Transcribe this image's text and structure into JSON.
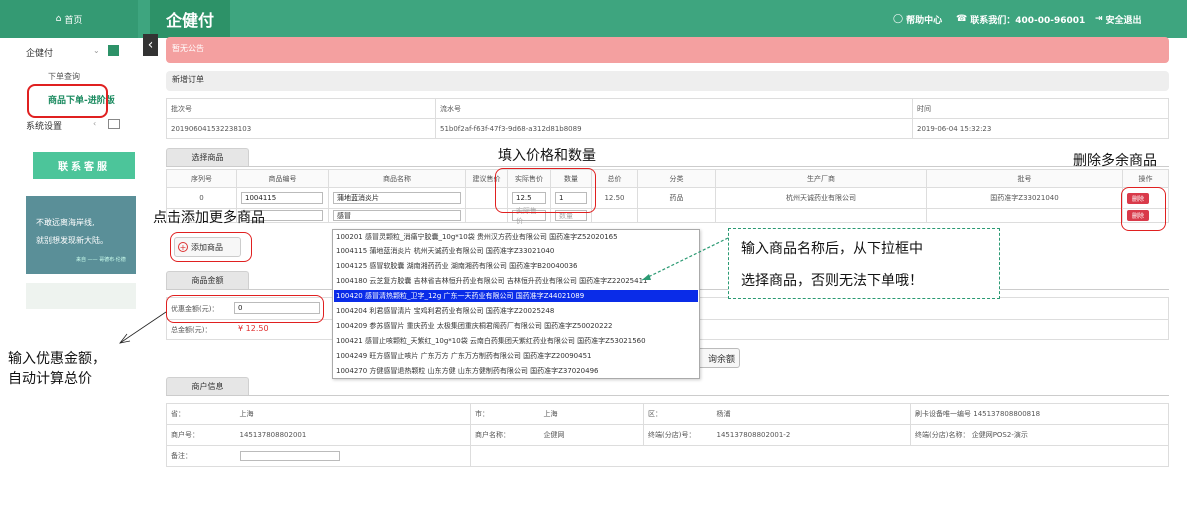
{
  "topbar": {
    "home": "首页",
    "brand": "企健付",
    "help": "帮助中心",
    "contact": "联系我们：400-00-96001",
    "logout": "安全退出"
  },
  "sidebar": {
    "group1": "企健付",
    "item_query": "下单查询",
    "item_order": "商品下单-进阶版",
    "group2": "系统设置",
    "kefu": "联系客服",
    "promo_line1": "不敢远离海岸线,",
    "promo_line2": "就别想发现新大陆。",
    "promo_line3": "来自 —— 哥德布·伦德"
  },
  "notice": "暂无公告",
  "new_order": {
    "title": "新增订单",
    "batch_label": "批次号",
    "batch_value": "201906041532238103",
    "serial_label": "流水号",
    "serial_value": "51b0f2af-f63f-47f3-9d68-a312d81b8089",
    "time_label": "时间",
    "time_value": "2019-06-04 15:32:23"
  },
  "goods": {
    "title": "选择商品",
    "columns": [
      "序列号",
      "商品编号",
      "商品名称",
      "建议售价",
      "实际售价",
      "数量",
      "总价",
      "分类",
      "生产厂商",
      "批号",
      "操作"
    ],
    "row1": {
      "seq": "0",
      "code": "1004115",
      "name": "蒲地蓝消炎片",
      "price": "12.5",
      "qty": "1",
      "total": "12.50",
      "category": "药品",
      "maker": "杭州天诚药业有限公司",
      "batch": "国药准字Z33021040",
      "action": "删除"
    },
    "row2": {
      "name": "感冒",
      "price_ph": "实际售价",
      "qty_ph": "数量",
      "action": "删除"
    },
    "add_button": "添加商品"
  },
  "dropdown": [
    "100201 感冒灵颗粒_消痛宁胶囊_10g*10袋 贵州汉方药业有限公司 国药准字Z52020165",
    "1004115 蒲地蓝消炎片 杭州天诚药业有限公司 国药准字Z33021040",
    "1004125 感冒软胶囊 湖南湘药药业 湖南湘药有限公司 国药准字B20040036",
    "1004180 云芝复方胶囊 吉林省吉林恒升药业有限公司 吉林恒升药业有限公司 国药准字Z22025411",
    "100420 感冒清热颗粒_卫字_12g 广东一天药业有限公司 国药准字Z44021089",
    "1004204 利君感冒清片 宝鸡利君药业有限公司 国药准字Z20025248",
    "1004209 参苏感冒片 重庆药业 太极集团重庆桐君阁药厂有限公司 国药准字Z50020222",
    "100421 感冒止咳颗粒_天紫红_10g*10袋 云南白药集团天紫红药业有限公司 国药准字Z53021560",
    "1004249 旺方感冒止咳片 广东万方 广东万方制药有限公司 国药准字Z20090451",
    "1004270 方健感冒退热颗粒 山东方健 山东方健制药有限公司 国药准字Z37020496"
  ],
  "amount": {
    "title": "商品金额",
    "discount_label": "优惠金额(元)：",
    "discount_value": "0",
    "total_label": "总金额(元)：",
    "total_value": "¥ 12.50",
    "query_button": "询余额"
  },
  "merchant": {
    "title": "商户信息",
    "province_label": "省：",
    "province_value": "上海",
    "city_label": "市：",
    "city_value": "上海",
    "district_label": "区：",
    "district_value": "杨浦",
    "device_label": "刷卡设备唯一编号",
    "device_value": "145137808800818",
    "merchant_no_label": "商户号：",
    "merchant_no_value": "145137808802001",
    "merchant_name_label": "商户名称：",
    "merchant_name_value": "企健网",
    "terminal_label": "终端(分店)号：",
    "terminal_value": "145137808802001-2",
    "terminal_name_label": "终端(分店)名称：",
    "terminal_name_value": "企健网POS2-演示",
    "remark_label": "备注："
  },
  "annotations": {
    "fill_price": "填入价格和数量",
    "delete_extra": "删除多余商品",
    "add_more": "点击添加更多商品",
    "tip_line1": "输入商品名称后，从下拉框中",
    "tip_line2": "选择商品，否则无法下单哦！",
    "discount_line1": "输入优惠金额，",
    "discount_line2": "自动计算总价"
  },
  "colors": {
    "primary": "#3ea57f",
    "notice": "#f4a0a0",
    "highlight": "#0a2ce8",
    "annotation_box": "#e02020"
  }
}
